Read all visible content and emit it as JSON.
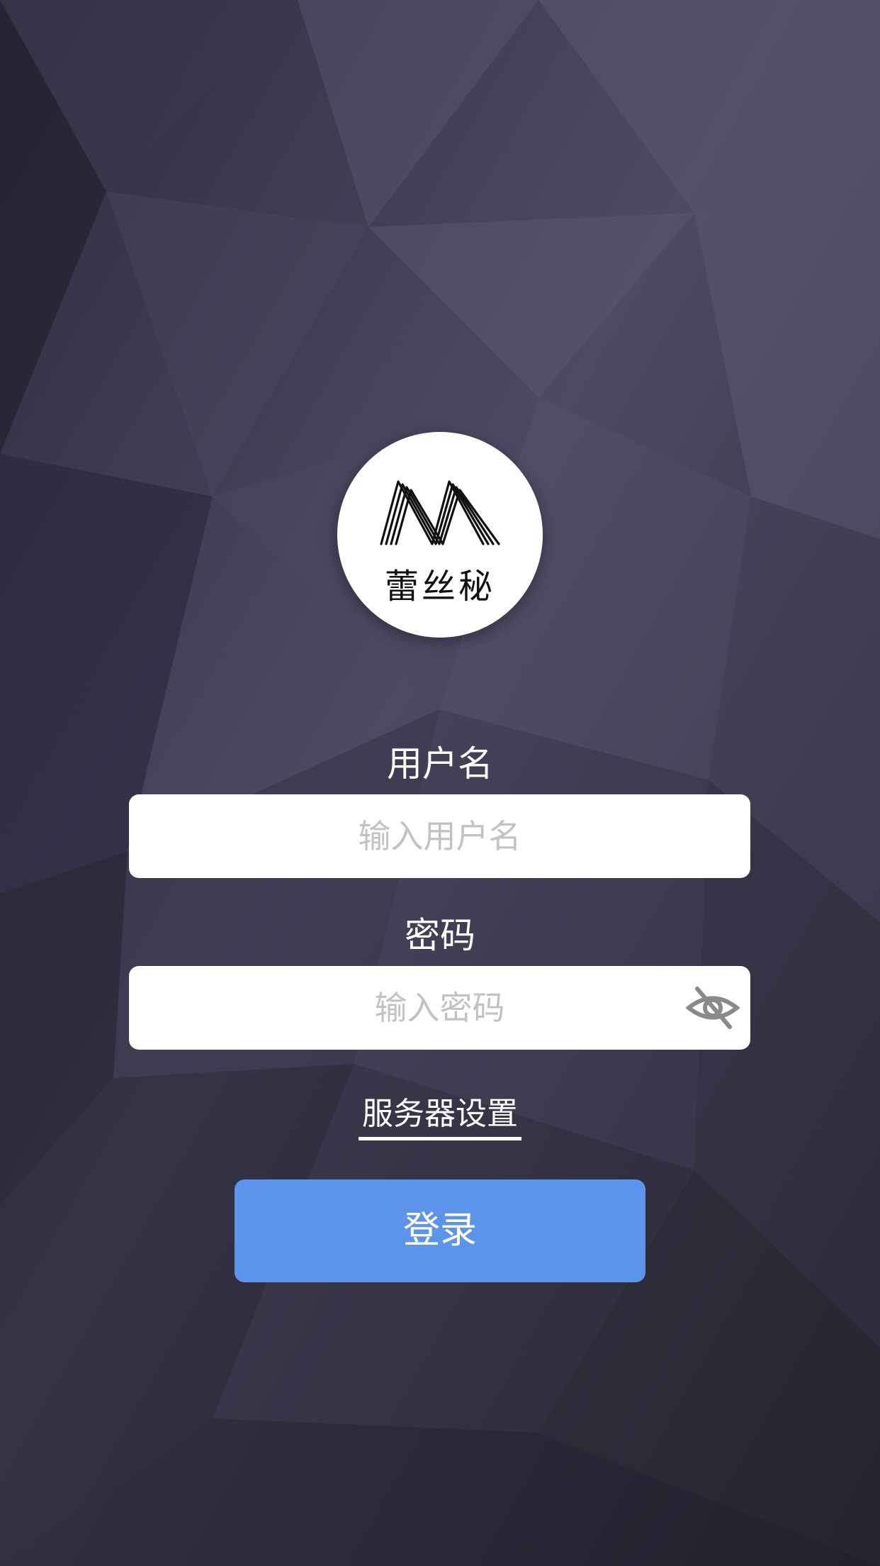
{
  "app": {
    "logo_text": "蕾丝秘",
    "logo_icon": "m-logo-icon"
  },
  "form": {
    "username": {
      "label": "用户名",
      "placeholder": "输入用户名",
      "value": ""
    },
    "password": {
      "label": "密码",
      "placeholder": "输入密码",
      "value": "",
      "toggle_icon": "eye-off-icon"
    },
    "server_settings_label": "服务器设置",
    "login_label": "登录"
  },
  "colors": {
    "background": "#2b2a3a",
    "accent": "#5b94ea",
    "input_bg": "#ffffff",
    "placeholder": "#c2c2c6"
  }
}
